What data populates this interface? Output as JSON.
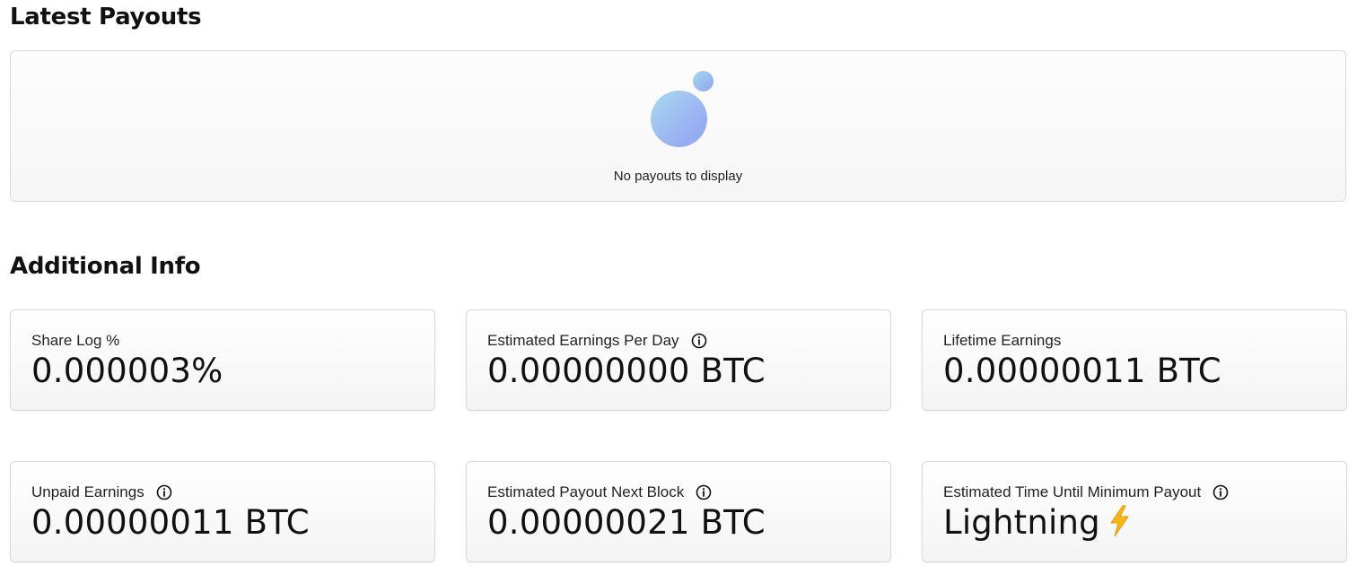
{
  "sections": {
    "payouts_title": "Latest Payouts",
    "info_title": "Additional Info"
  },
  "payouts": {
    "empty_message": "No payouts to display"
  },
  "cards": [
    {
      "label": "Share Log %",
      "value": "0.000003%",
      "has_info": false
    },
    {
      "label": "Estimated Earnings Per Day",
      "value": "0.00000000 BTC",
      "has_info": true
    },
    {
      "label": "Lifetime Earnings",
      "value": "0.00000011 BTC",
      "has_info": false
    },
    {
      "label": "Unpaid Earnings",
      "value": "0.00000011 BTC",
      "has_info": true
    },
    {
      "label": "Estimated Payout Next Block",
      "value": "0.00000021 BTC",
      "has_info": true
    },
    {
      "label": "Estimated Time Until Minimum Payout",
      "value": "Lightning",
      "value_icon": "lightning-bolt-icon",
      "has_info": true
    }
  ],
  "colors": {
    "bolt": "#f5b51b",
    "bubble_start": "#a8dcef",
    "bubble_end": "#8ea3f0"
  }
}
